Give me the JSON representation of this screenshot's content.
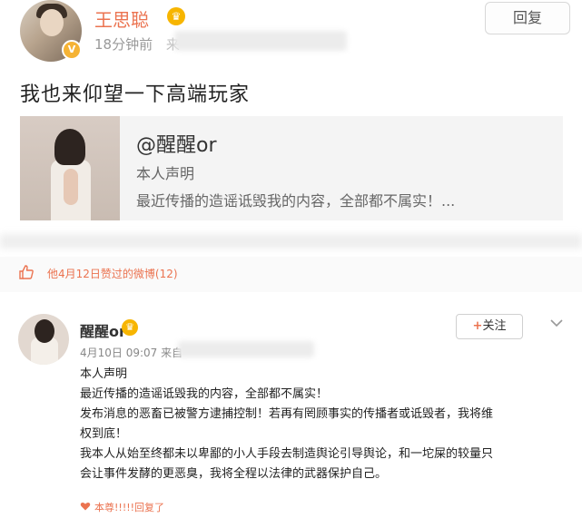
{
  "post": {
    "username": "王思聪",
    "crown_glyph": "♛",
    "verified_glyph": "V",
    "time": "18分钟前",
    "source_fragment": "来",
    "reply_label": "回复",
    "text": "我也来仰望一下高端玩家",
    "card": {
      "title": "@醒醒or",
      "line1": "本人声明",
      "line2": "最近传播的造谣诋毁我的内容，全部都不属实！..."
    }
  },
  "likes": {
    "icon": "thumb-up-icon",
    "text": "他4月12日赞过的微博(12)"
  },
  "repost": {
    "username": "醒醒or",
    "crown_glyph": "♛",
    "follow_plus": "+",
    "follow_label": "关注",
    "time": "4月10日 09:07 来自",
    "lines": [
      "本人声明",
      "最近传播的造谣诋毁我的内容，全部都不属实！",
      "发布消息的恶畜已被警方逮捕控制！若再有罔顾事实的传播者或诋毁者，我将维",
      "权到底！",
      "我本人从始至终都未以卑鄙的小人手段去制造舆论引导舆论，和一坨屎的较量只",
      "会让事件发酵的更恶臭，我将全程以法律的武器保护自己。"
    ],
    "bottom_text": "本尊!!!!!回复了"
  },
  "colors": {
    "accent": "#eb7350",
    "gold": "#f7b500"
  }
}
